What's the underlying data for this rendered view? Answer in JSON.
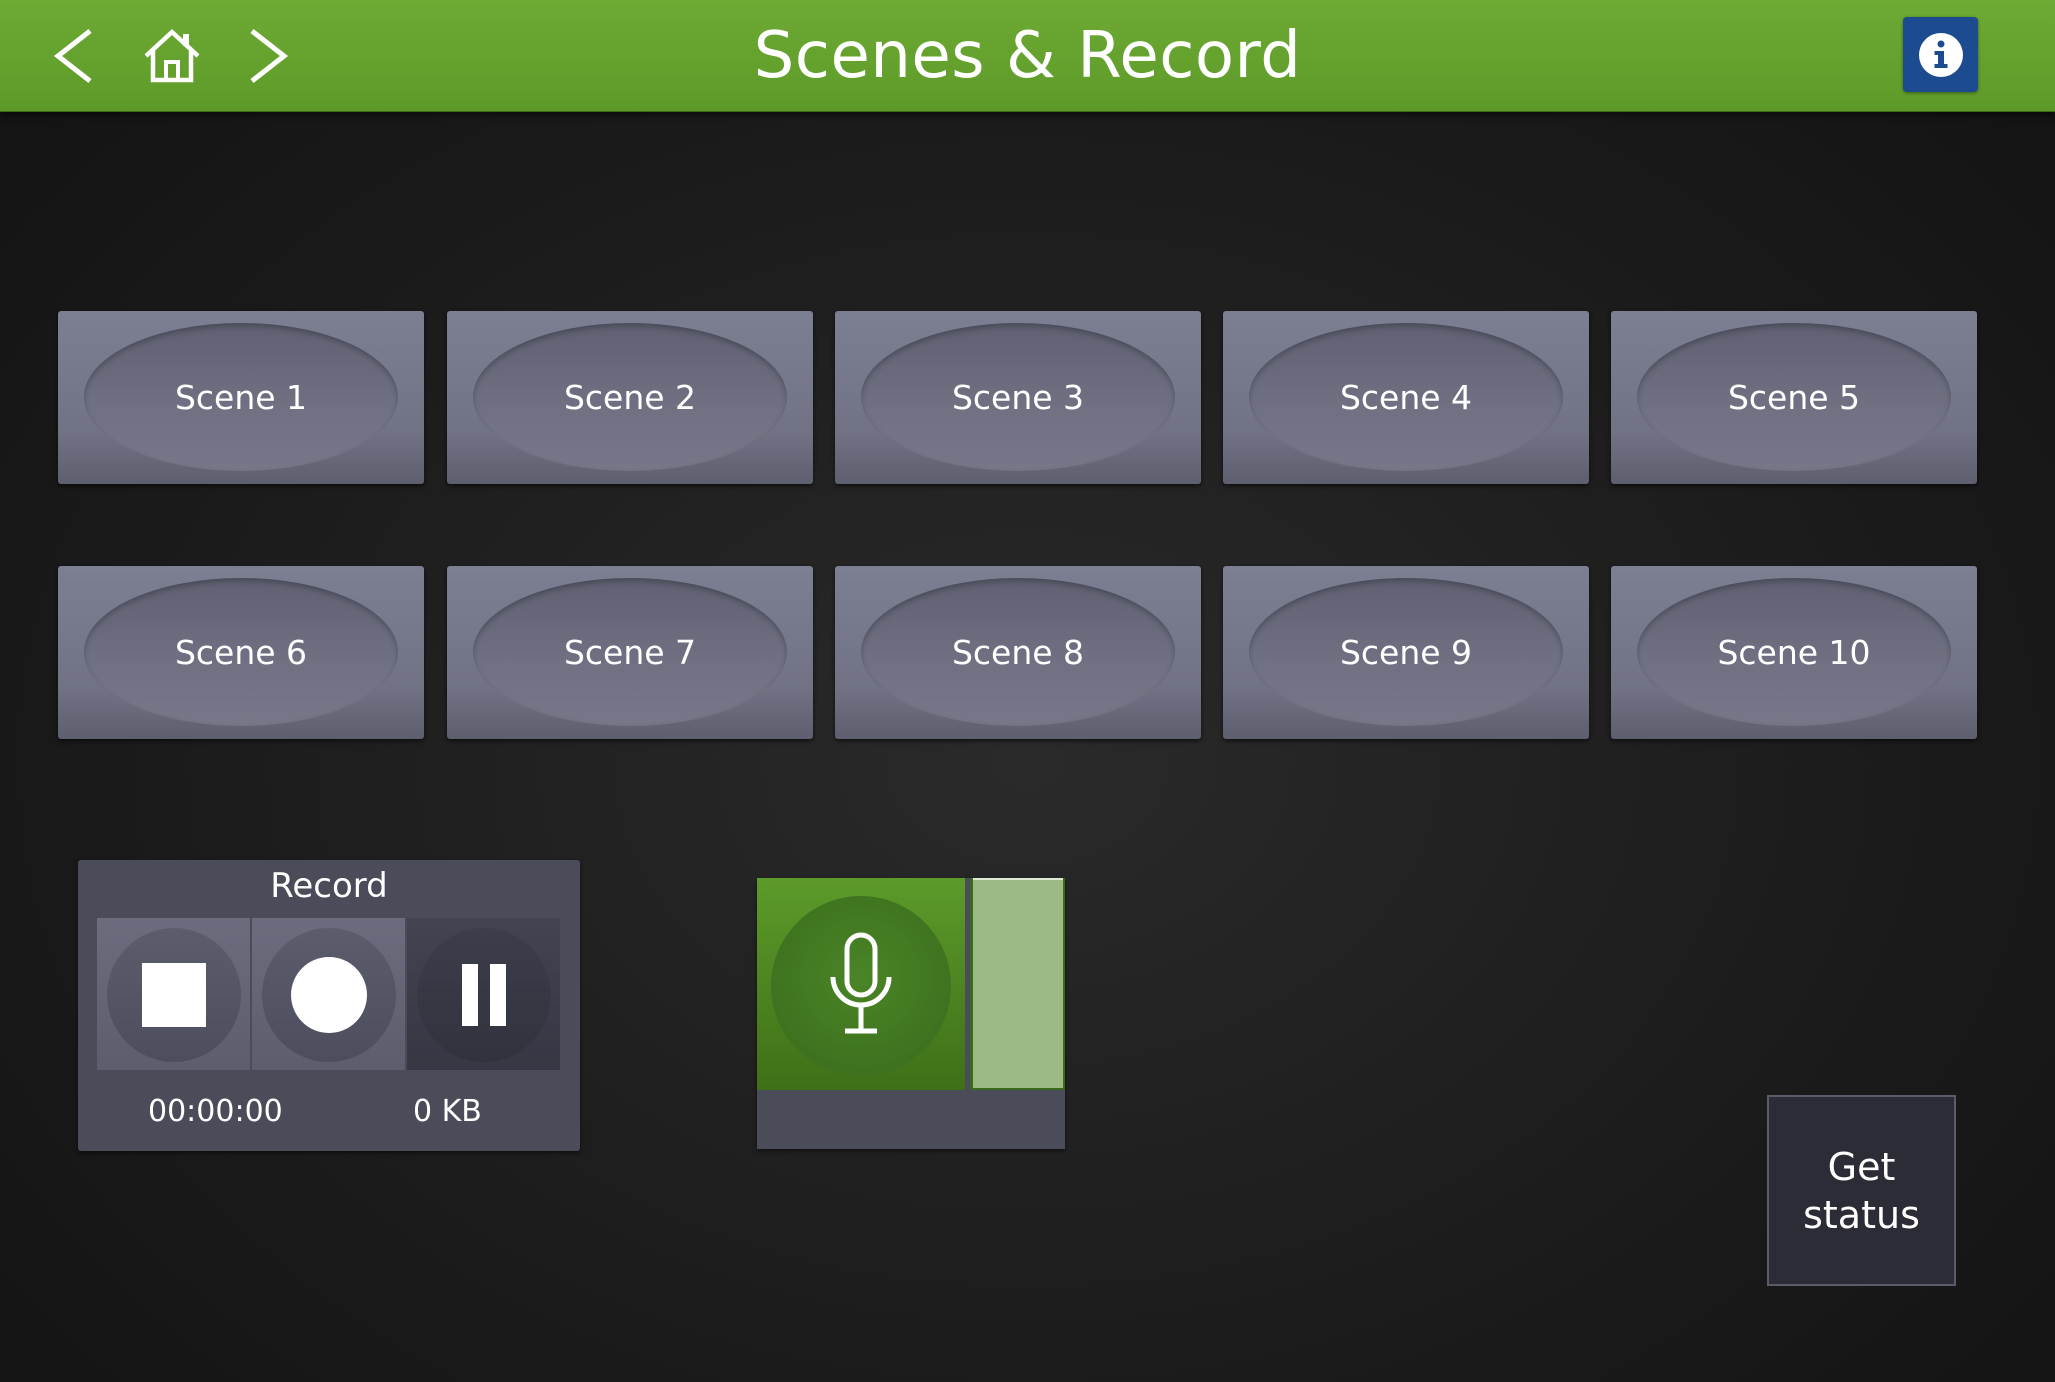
{
  "header": {
    "title": "Scenes & Record",
    "icons": {
      "back": "chevron-left-icon",
      "home": "home-icon",
      "forward": "chevron-right-icon",
      "info": "info-icon"
    },
    "colors": {
      "bar": "#64a02e",
      "info_button": "#1d4b8f"
    }
  },
  "scenes": [
    {
      "label": "Scene 1"
    },
    {
      "label": "Scene 2"
    },
    {
      "label": "Scene 3"
    },
    {
      "label": "Scene 4"
    },
    {
      "label": "Scene 5"
    },
    {
      "label": "Scene 6"
    },
    {
      "label": "Scene 7"
    },
    {
      "label": "Scene 8"
    },
    {
      "label": "Scene 9"
    },
    {
      "label": "Scene 10"
    }
  ],
  "record": {
    "title": "Record",
    "controls": [
      {
        "name": "stop",
        "icon": "stop-icon"
      },
      {
        "name": "record",
        "icon": "record-icon"
      },
      {
        "name": "pause",
        "icon": "pause-icon",
        "active": true
      }
    ],
    "elapsed": "00:00:00",
    "size": "0 KB"
  },
  "microphone": {
    "icon": "microphone-icon",
    "state": "on",
    "level": 1.0,
    "color": "#4a8526"
  },
  "status_button": {
    "line1": "Get",
    "line2": "status"
  }
}
